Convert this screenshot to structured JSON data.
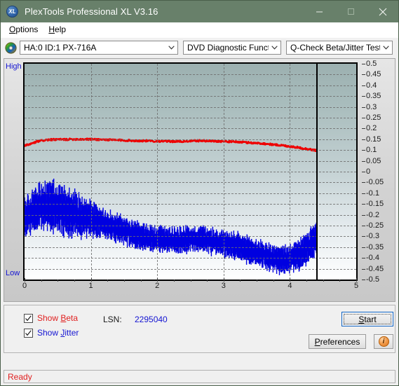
{
  "window": {
    "title": "PlexTools Professional XL V3.16",
    "icon": "xl-logo-icon",
    "minimize_label": "Minimize",
    "maximize_label": "Maximize",
    "close_label": "Close",
    "titlebar_color": "#68806a"
  },
  "menu": {
    "items": [
      {
        "label": "Options",
        "accel": "O"
      },
      {
        "label": "Help",
        "accel": "H"
      }
    ]
  },
  "toolbar": {
    "drive_icon": "optical-disc-icon",
    "drive_select": "HA:0 ID:1  PX-716A",
    "function_select": "DVD Diagnostic Functions",
    "test_select": "Q-Check Beta/Jitter Test"
  },
  "chart_data": {
    "type": "line",
    "title": "Q-Check Beta/Jitter Test",
    "xlabel": "",
    "ylabel": "",
    "grid": true,
    "xlim": [
      0,
      5
    ],
    "ylim": [
      -0.5,
      0.5
    ],
    "xticks": [
      0,
      1,
      2,
      3,
      4,
      5
    ],
    "yticks": [
      0.5,
      0.45,
      0.4,
      0.35,
      0.3,
      0.25,
      0.2,
      0.15,
      0.1,
      0.05,
      0,
      -0.05,
      -0.1,
      -0.15,
      -0.2,
      -0.25,
      -0.3,
      -0.35,
      -0.4,
      -0.45,
      -0.5
    ],
    "ytick_labels": [
      "0.5",
      "0.45",
      "0.4",
      "0.35",
      "0.3",
      "0.25",
      "0.2",
      "0.15",
      "0.1",
      "0.05",
      "0",
      "-0.05",
      "-0.1",
      "-0.15",
      "-0.2",
      "-0.25",
      "-0.3",
      "-0.35",
      "-0.4",
      "-0.45",
      "-0.5"
    ],
    "axis_top_label": "High",
    "axis_bottom_label": "Low",
    "data_end_marker_x": 4.4,
    "legend_position": "below-plot",
    "series": [
      {
        "name": "Beta",
        "color": "#ee0000",
        "x": [
          0.0,
          0.1,
          0.2,
          0.3,
          0.4,
          0.5,
          0.6,
          0.7,
          0.8,
          0.9,
          1.0,
          1.1,
          1.2,
          1.3,
          1.4,
          1.5,
          1.6,
          1.7,
          1.8,
          1.9,
          2.0,
          2.1,
          2.2,
          2.3,
          2.4,
          2.5,
          2.6,
          2.7,
          2.8,
          2.9,
          3.0,
          3.1,
          3.2,
          3.3,
          3.4,
          3.5,
          3.6,
          3.7,
          3.8,
          3.9,
          4.0,
          4.1,
          4.2,
          4.3,
          4.4
        ],
        "values": [
          0.12,
          0.129,
          0.14,
          0.146,
          0.148,
          0.149,
          0.149,
          0.15,
          0.15,
          0.15,
          0.15,
          0.149,
          0.148,
          0.147,
          0.146,
          0.145,
          0.144,
          0.143,
          0.143,
          0.142,
          0.141,
          0.141,
          0.14,
          0.14,
          0.14,
          0.142,
          0.143,
          0.143,
          0.142,
          0.141,
          0.14,
          0.139,
          0.138,
          0.136,
          0.134,
          0.132,
          0.13,
          0.127,
          0.124,
          0.121,
          0.117,
          0.113,
          0.108,
          0.103,
          0.098
        ],
        "noise": 0.004
      },
      {
        "name": "Jitter",
        "color": "#0000e0",
        "x": [
          0.0,
          0.1,
          0.2,
          0.3,
          0.4,
          0.5,
          0.6,
          0.7,
          0.8,
          0.9,
          1.0,
          1.1,
          1.2,
          1.3,
          1.4,
          1.5,
          1.6,
          1.7,
          1.8,
          1.9,
          2.0,
          2.1,
          2.2,
          2.3,
          2.4,
          2.5,
          2.6,
          2.7,
          2.8,
          2.9,
          3.0,
          3.1,
          3.2,
          3.3,
          3.4,
          3.5,
          3.6,
          3.7,
          3.8,
          3.9,
          4.0,
          4.1,
          4.2,
          4.3,
          4.4
        ],
        "values": [
          -0.215,
          -0.19,
          -0.17,
          -0.16,
          -0.163,
          -0.172,
          -0.182,
          -0.192,
          -0.205,
          -0.215,
          -0.222,
          -0.232,
          -0.242,
          -0.252,
          -0.262,
          -0.272,
          -0.284,
          -0.294,
          -0.302,
          -0.308,
          -0.312,
          -0.314,
          -0.316,
          -0.318,
          -0.317,
          -0.314,
          -0.312,
          -0.314,
          -0.32,
          -0.326,
          -0.332,
          -0.34,
          -0.348,
          -0.356,
          -0.366,
          -0.376,
          -0.386,
          -0.396,
          -0.404,
          -0.408,
          -0.404,
          -0.392,
          -0.372,
          -0.34,
          -0.305
        ],
        "band_half_width": 0.048
      }
    ]
  },
  "controls": {
    "show_beta": {
      "label": "Show Beta",
      "accel": "B",
      "checked": true,
      "color": "#e02020"
    },
    "show_jitter": {
      "label": "Show Jitter",
      "accel": "J",
      "checked": true,
      "color": "#1414d2"
    },
    "lsn_label": "LSN:",
    "lsn_value": "2295040",
    "start_button": "Start",
    "start_accel": "S",
    "preferences_button": "Preferences",
    "preferences_accel": "P",
    "info_button": "i"
  },
  "statusbar": {
    "text": "Ready",
    "color": "#e02020"
  }
}
